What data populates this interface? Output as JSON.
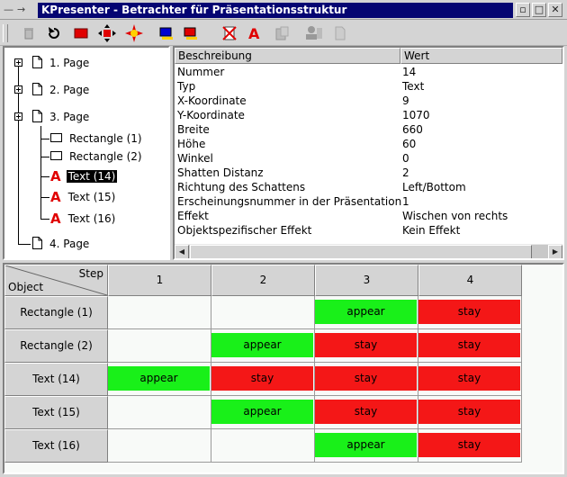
{
  "window": {
    "title": "KPresenter - Betrachter für Präsentationsstruktur",
    "menu_glyph": "—",
    "pin_glyph": "→",
    "buttons": {
      "shade": "▫",
      "maximize": "□",
      "close": "✕"
    }
  },
  "toolbar": {
    "buttons": [
      {
        "name": "trash-icon"
      },
      {
        "name": "undo-icon"
      },
      {
        "name": "red-rectangle-icon"
      },
      {
        "name": "move-arrows-icon"
      },
      {
        "name": "star-shape-icon"
      },
      {
        "name": "blue-rectangle-icon"
      },
      {
        "name": "red-square-icon"
      },
      {
        "name": "strikeout-page-icon"
      },
      {
        "name": "text-a-icon"
      },
      {
        "name": "paste-icon"
      },
      {
        "name": "presenter-icon"
      },
      {
        "name": "document-icon"
      }
    ]
  },
  "tree": {
    "nodes": [
      {
        "label": "1. Page",
        "kind": "page",
        "level": 0
      },
      {
        "label": "2. Page",
        "kind": "page",
        "level": 0
      },
      {
        "label": "3. Page",
        "kind": "page",
        "level": 0
      },
      {
        "label": "Rectangle (1)",
        "kind": "rect",
        "level": 1
      },
      {
        "label": "Rectangle (2)",
        "kind": "rect",
        "level": 1
      },
      {
        "label": "Text (14)",
        "kind": "text",
        "level": 1,
        "selected": true
      },
      {
        "label": "Text (15)",
        "kind": "text",
        "level": 1
      },
      {
        "label": "Text (16)",
        "kind": "text",
        "level": 1
      },
      {
        "label": "4. Page",
        "kind": "page",
        "level": 0
      }
    ],
    "text_icon_glyph": "A"
  },
  "properties": {
    "headers": {
      "description": "Beschreibung",
      "value": "Wert"
    },
    "rows": [
      {
        "key": "Nummer",
        "value": "14"
      },
      {
        "key": "Typ",
        "value": "Text"
      },
      {
        "key": "X-Koordinate",
        "value": "9"
      },
      {
        "key": "Y-Koordinate",
        "value": "1070"
      },
      {
        "key": "Breite",
        "value": "660"
      },
      {
        "key": "Höhe",
        "value": "60"
      },
      {
        "key": "Winkel",
        "value": "0"
      },
      {
        "key": "Shatten Distanz",
        "value": "2"
      },
      {
        "key": "Richtung des Schattens",
        "value": "Left/Bottom"
      },
      {
        "key": "Erscheinungsnummer in der Präsentation",
        "value": "1"
      },
      {
        "key": "Effekt",
        "value": "Wischen von rechts"
      },
      {
        "key": "Objektspezifischer Effekt",
        "value": "Kein Effekt"
      }
    ],
    "scroll_left": "◀",
    "scroll_right": "▶"
  },
  "timeline": {
    "corner_step": "Step",
    "corner_object": "Object",
    "steps": [
      "1",
      "2",
      "3",
      "4"
    ],
    "rows": [
      {
        "object": "Rectangle (1)",
        "cells": [
          "",
          "",
          "appear",
          "stay"
        ]
      },
      {
        "object": "Rectangle (2)",
        "cells": [
          "",
          "appear",
          "stay",
          "stay"
        ]
      },
      {
        "object": "Text (14)",
        "cells": [
          "appear",
          "stay",
          "stay",
          "stay"
        ]
      },
      {
        "object": "Text (15)",
        "cells": [
          "",
          "appear",
          "stay",
          "stay"
        ]
      },
      {
        "object": "Text (16)",
        "cells": [
          "",
          "",
          "appear",
          "stay"
        ]
      }
    ],
    "colors": {
      "appear": "#19f019",
      "stay": "#f41717"
    }
  }
}
